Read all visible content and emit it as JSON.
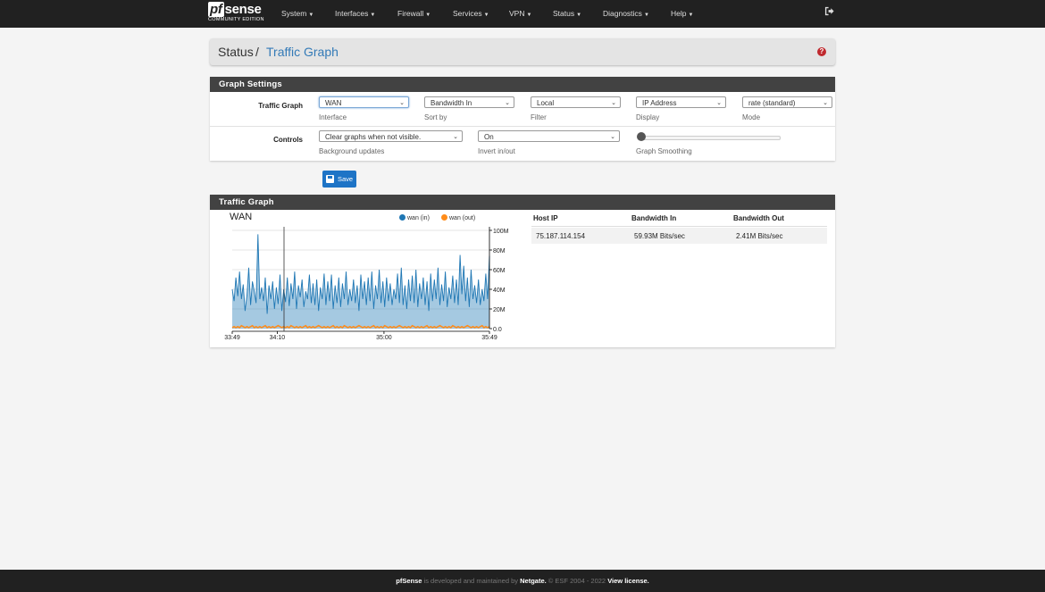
{
  "brand": {
    "name": "pfsense",
    "pf": "pf",
    "rest": "sense",
    "edition": "COMMUNITY EDITION"
  },
  "nav": {
    "items": [
      {
        "label": "System"
      },
      {
        "label": "Interfaces"
      },
      {
        "label": "Firewall"
      },
      {
        "label": "Services"
      },
      {
        "label": "VPN"
      },
      {
        "label": "Status"
      },
      {
        "label": "Diagnostics"
      },
      {
        "label": "Help"
      }
    ]
  },
  "breadcrumb": {
    "section": "Status",
    "separator": "/",
    "page": "Traffic Graph"
  },
  "settings": {
    "title": "Graph Settings",
    "traffic_graph_label": "Traffic Graph",
    "controls_label": "Controls",
    "interface": {
      "value": "WAN",
      "help": "Interface"
    },
    "sort_by": {
      "value": "Bandwidth In",
      "help": "Sort by"
    },
    "filter": {
      "value": "Local",
      "help": "Filter"
    },
    "display": {
      "value": "IP Address",
      "help": "Display"
    },
    "mode": {
      "value": "rate (standard)",
      "help": "Mode"
    },
    "background_updates": {
      "value": "Clear graphs when not visible.",
      "help": "Background updates"
    },
    "invert": {
      "value": "On",
      "help": "Invert in/out"
    },
    "smoothing": {
      "help": "Graph Smoothing",
      "level": 0
    }
  },
  "save_label": "Save",
  "traffic": {
    "title": "Traffic Graph",
    "graph_title": "WAN",
    "host_table": {
      "headers": [
        "Host IP",
        "Bandwidth In",
        "Bandwidth Out"
      ],
      "rows": [
        [
          "75.187.114.154",
          "59.93M Bits/sec",
          "2.41M Bits/sec"
        ]
      ]
    }
  },
  "chart_data": {
    "type": "area",
    "title": "WAN",
    "series": [
      {
        "name": "wan (in)",
        "color": "#1f77b4",
        "values": [
          40,
          28,
          52,
          33,
          58,
          30,
          45,
          18,
          34,
          62,
          24,
          48,
          38,
          26,
          96,
          30,
          42,
          28,
          52,
          15,
          44,
          30,
          48,
          20,
          42,
          25,
          55,
          18,
          40,
          27,
          52,
          23,
          46,
          30,
          58,
          20,
          44,
          32,
          50,
          22,
          38,
          30,
          55,
          26,
          46,
          24,
          50,
          18,
          42,
          30,
          56,
          24,
          48,
          28,
          55,
          20,
          44,
          26,
          52,
          22,
          46,
          30,
          58,
          24,
          40,
          28,
          50,
          26,
          44,
          18,
          55,
          30,
          48,
          24,
          52,
          28,
          58,
          20,
          44,
          30,
          60,
          26,
          48,
          22,
          52,
          28,
          46,
          24,
          40,
          30,
          56,
          26,
          62,
          24,
          44,
          20,
          50,
          28,
          54,
          26,
          60,
          22,
          46,
          30,
          52,
          24,
          48,
          18,
          56,
          28,
          50,
          30,
          62,
          24,
          45,
          28,
          58,
          22,
          42,
          30,
          54,
          26,
          50,
          24,
          75,
          35,
          64,
          28,
          52,
          22,
          60,
          30,
          44,
          26,
          50,
          24,
          40,
          28,
          56,
          30,
          74
        ]
      },
      {
        "name": "wan (out)",
        "color": "#ff8c1a",
        "values": [
          1,
          2,
          1,
          2,
          1,
          3,
          2,
          1,
          2,
          1,
          2,
          3,
          1,
          2,
          1,
          2,
          1,
          2,
          3,
          1,
          2,
          1,
          2,
          1,
          2,
          3,
          2,
          1,
          2,
          1,
          2,
          1,
          3,
          2,
          1,
          2,
          1,
          2,
          1,
          2,
          3,
          1,
          2,
          1,
          2,
          1,
          2,
          3,
          2,
          1,
          2,
          1,
          2,
          1,
          2,
          3,
          1,
          2,
          1,
          2,
          1,
          3,
          2,
          1,
          2,
          1,
          2,
          1,
          2,
          3,
          2,
          1,
          2,
          1,
          2,
          1,
          2,
          3,
          1,
          2,
          1,
          2,
          1,
          3,
          2,
          1,
          2,
          1,
          2,
          1,
          2,
          3,
          2,
          1,
          2,
          1,
          2,
          1,
          3,
          2,
          1,
          2,
          1,
          2,
          1,
          2,
          3,
          1,
          2,
          1,
          2,
          1,
          2,
          3,
          2,
          1,
          2,
          1,
          2,
          1,
          3,
          2,
          1,
          2,
          1,
          2,
          1,
          2,
          3,
          2,
          1,
          2,
          1,
          2,
          1,
          2,
          3,
          1,
          2,
          1,
          2
        ]
      }
    ],
    "y_ticks": [
      "0.0",
      "20M",
      "40M",
      "60M",
      "80M",
      "100M"
    ],
    "ylim": [
      0,
      100
    ],
    "x_ticks": [
      "33:49",
      "34:10",
      "35:00",
      "35:49"
    ],
    "x_tick_fractions": [
      0,
      0.175,
      0.59,
      1
    ],
    "grid": true,
    "legend": "top-right"
  },
  "footer": {
    "brand": "pfSense",
    "text1": " is developed and maintained by ",
    "company": "Netgate.",
    "text2": " © ESF 2004 - 2022 ",
    "license": "View license."
  }
}
